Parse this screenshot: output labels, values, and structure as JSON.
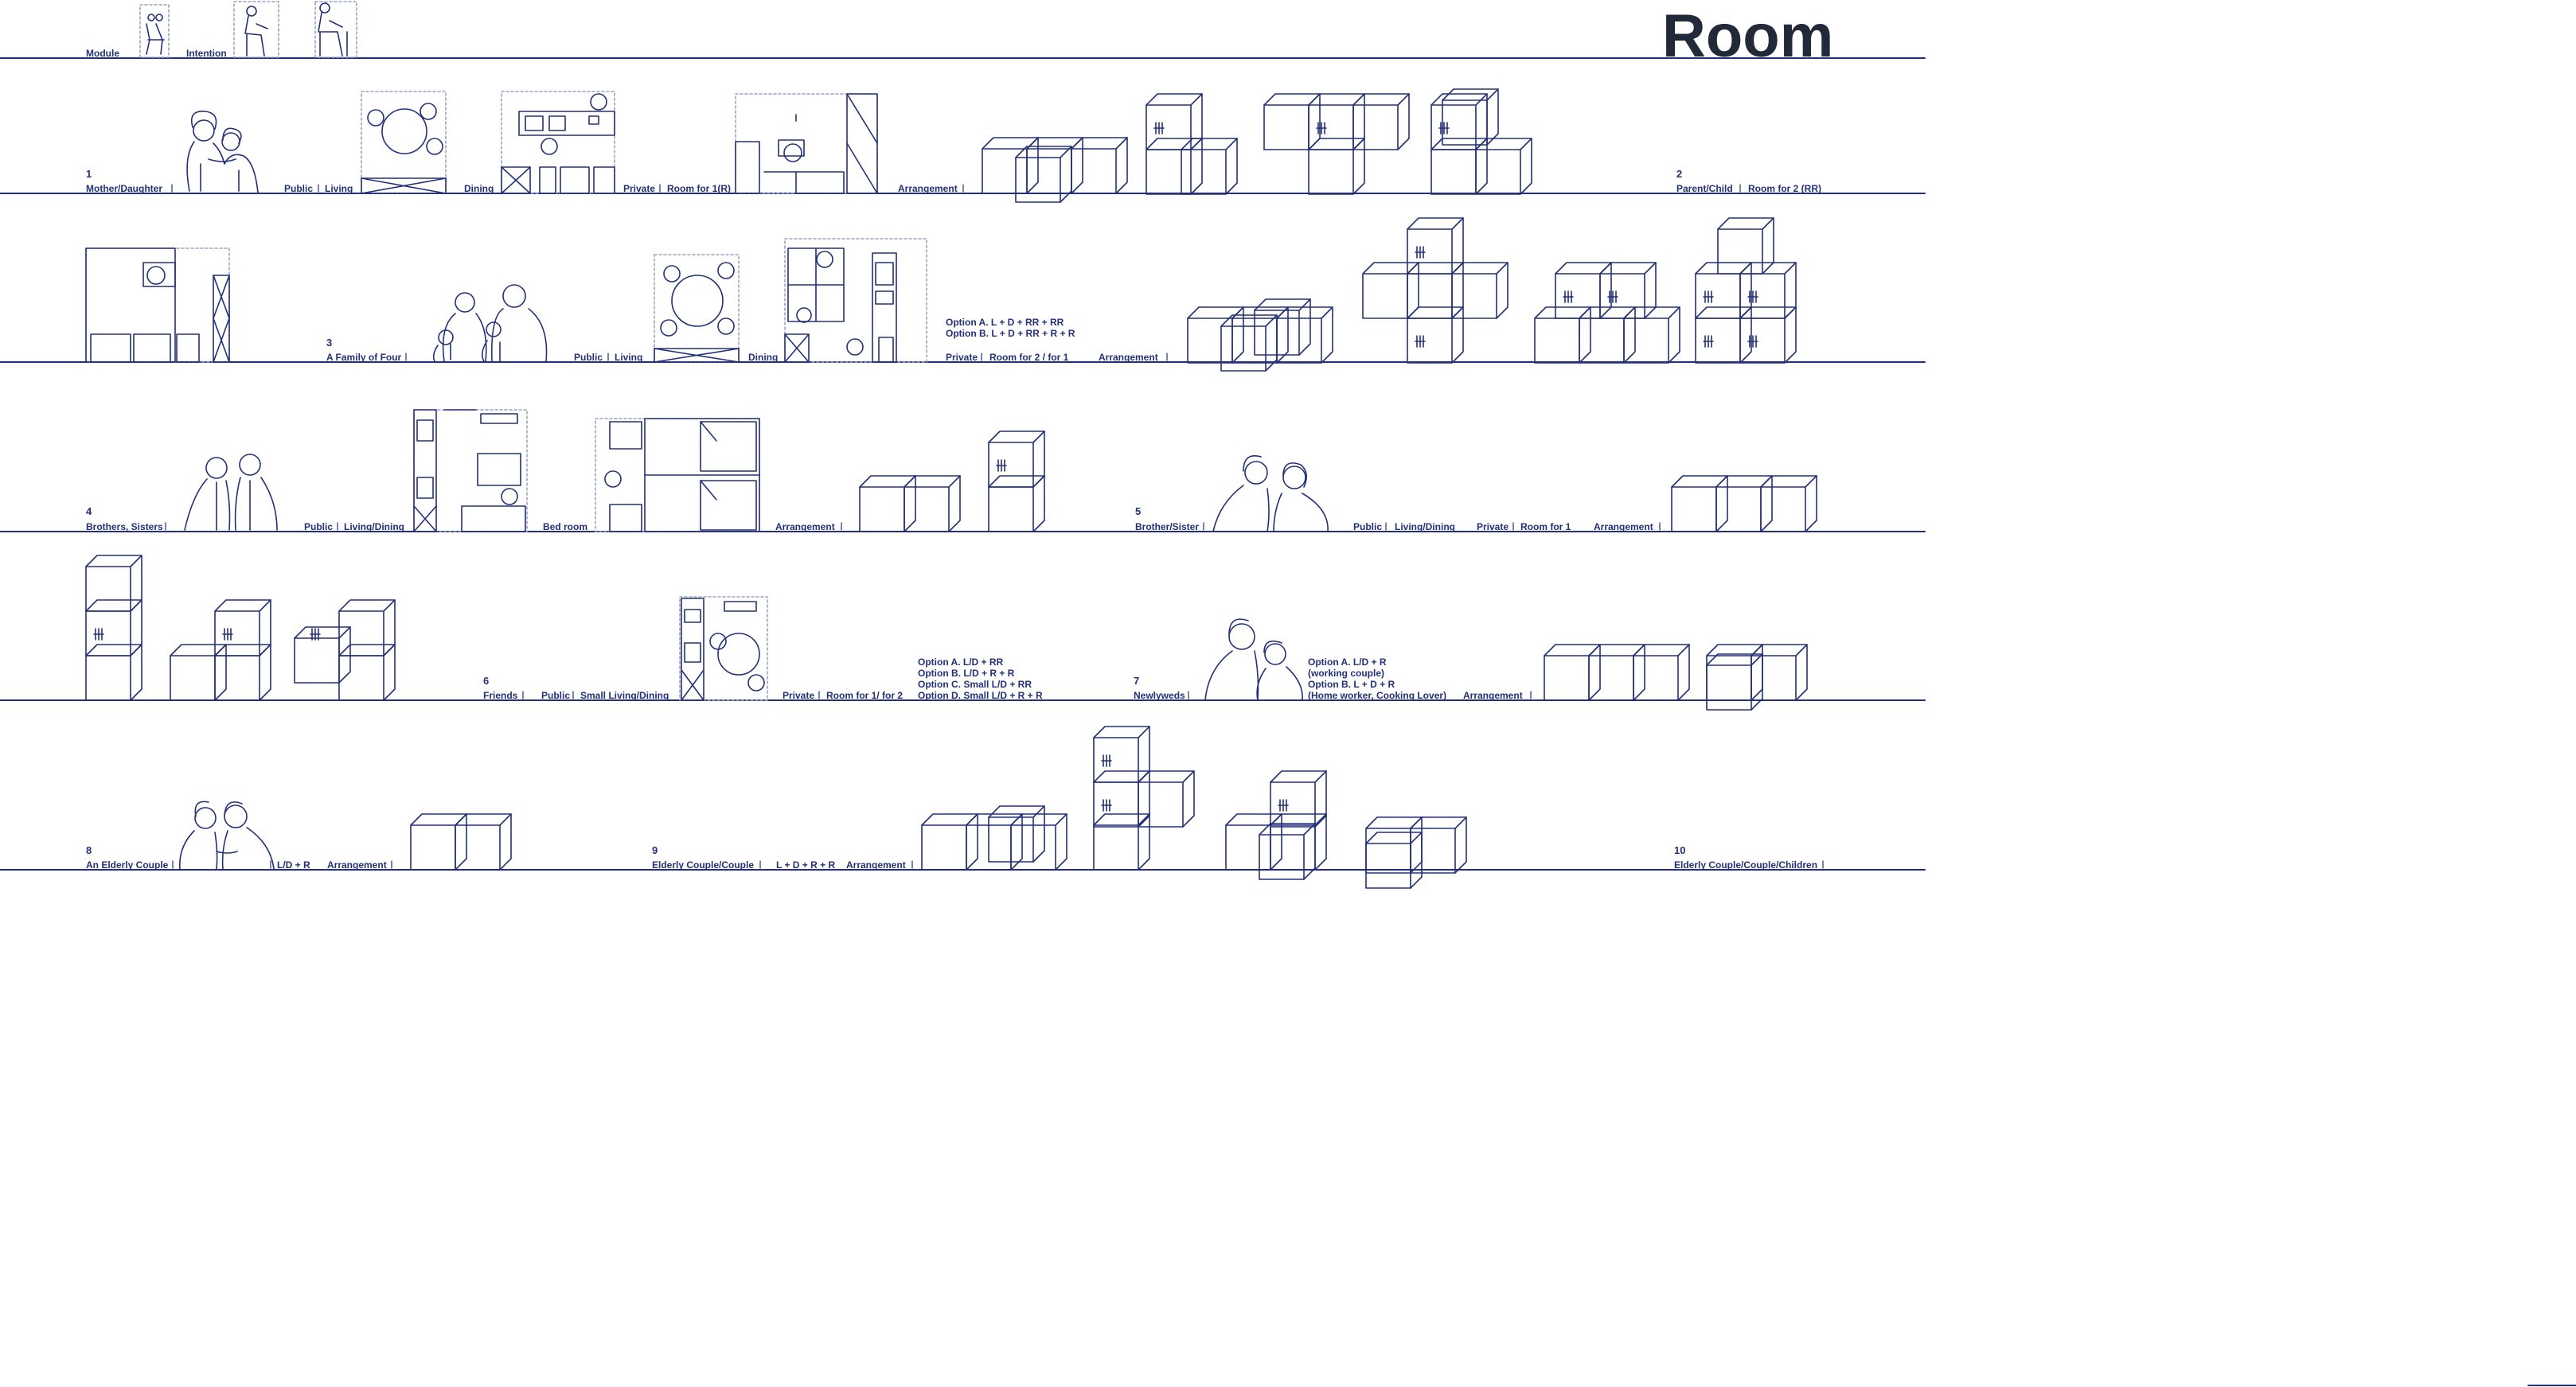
{
  "title": "Room",
  "header": {
    "module": "Module",
    "intention": "Intention"
  },
  "colors": {
    "ink": "#23307a",
    "title": "#222a3a",
    "guide": "#9aa2c6",
    "background": "#ffffff"
  },
  "rows": [
    {
      "number": "1",
      "group": "Mother/Daughter",
      "labels": [
        "Public",
        "Living",
        "Dining",
        "Private",
        "Room for 1(R)",
        "Arrangement"
      ]
    },
    {
      "number": "2",
      "group": "Parent/Child",
      "labels": [
        "Room for 2 (RR)",
        "A Family of Four",
        "Public",
        "Living",
        "Dining",
        "Private",
        "Room for 2 / for 1",
        "Arrangement"
      ],
      "options": [
        "Option A.  L + D + RR + RR",
        "Option B.  L + D + RR + R + R"
      ]
    },
    {
      "number": "4",
      "group": "Brothers, Sisters",
      "labels": [
        "Public",
        "Living/Dining",
        "Bed room",
        "Arrangement"
      ]
    },
    {
      "number": "5",
      "group": "Brother/Sister",
      "labels": [
        "Public",
        "Living/Dining",
        "Private",
        "Room for 1",
        "Arrangement"
      ]
    },
    {
      "number": "6",
      "group": "Friends",
      "labels": [
        "Public",
        "Small Living/Dining",
        "Private",
        "Room for 1/ for 2"
      ],
      "options": [
        "Option A.  L/D + RR",
        "Option B.  L/D + R + R",
        "Option C.  Small L/D + RR",
        "Option D.  Small L/D + R + R"
      ]
    },
    {
      "number": "7",
      "group": "Newlyweds",
      "labels": [
        "Arrangement"
      ],
      "options": [
        "Option A.    L/D + R",
        "(working couple)",
        "Option B.    L + D + R",
        "(Home worker, Cooking Lover)"
      ]
    },
    {
      "number": "8",
      "group": "An Elderly Couple",
      "labels": [
        "L/D + R",
        "Arrangement"
      ]
    },
    {
      "number": "9",
      "group": "Elderly Couple/Couple",
      "labels": [
        "L + D + R + R",
        "Arrangement"
      ]
    },
    {
      "number": "10",
      "group": "Elderly Couple/Couple/Children",
      "labels": []
    }
  ],
  "row3_number": "3"
}
